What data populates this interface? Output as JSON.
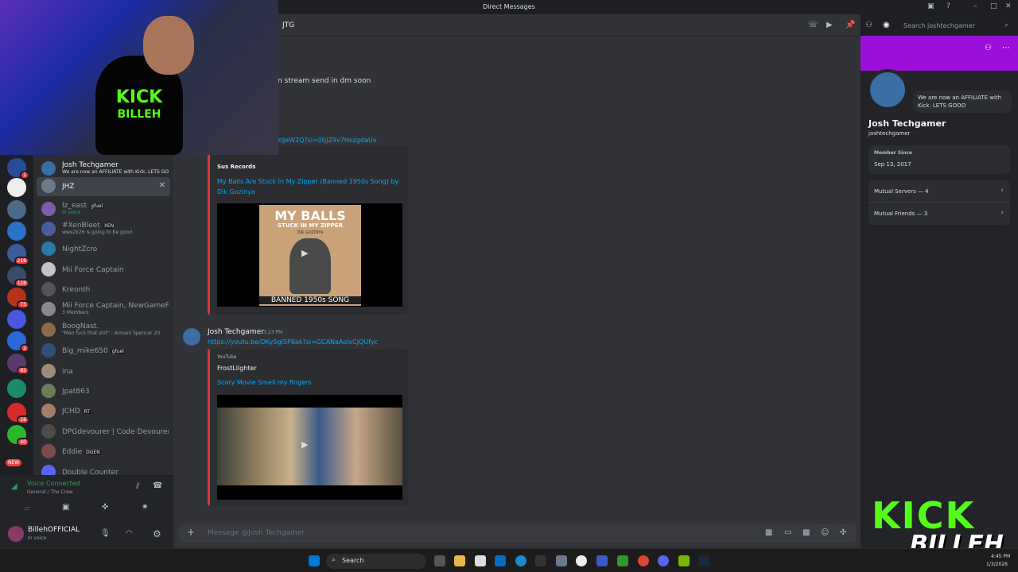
{
  "window": {
    "title": "Direct Messages"
  },
  "header": {
    "channel_name": "JTG",
    "search_placeholder": "Search joshtechgamer"
  },
  "dm_list": [
    {
      "name": "Josh Techgamer",
      "sub": "We are now an AFFILIATE with Kick. LETS GO",
      "color": "#3a6ea5"
    },
    {
      "name": "JHZ",
      "sub": "",
      "active": true,
      "color": "#6b7b8c"
    },
    {
      "name": "Iz_east",
      "tag": "gfuel",
      "sub": "In voice",
      "color": "#7b5ea7"
    },
    {
      "name": "#XenBleet",
      "tag": "XEN",
      "sub": "wwe2k26 is going to be good",
      "color": "#4b5b9c"
    },
    {
      "name": "NightZcro",
      "sub": "",
      "color": "#2d7aa8"
    },
    {
      "name": "Mii Force Captain",
      "sub": "",
      "color": "#c4c4c4"
    },
    {
      "name": "Kreonth",
      "sub": "",
      "color": "#555555"
    },
    {
      "name": "Mii Force Captain, NewGameFa...",
      "sub": "3 Members",
      "color": "#888888"
    },
    {
      "name": "BoogNast.",
      "sub": "\"Man fuck that shit\" - Armani Spencer 20",
      "color": "#8c6a4a"
    },
    {
      "name": "Big_mike650",
      "tag": "gfuel",
      "sub": "",
      "color": "#2f4f7f"
    },
    {
      "name": "ina",
      "sub": "",
      "color": "#9c8c7c"
    },
    {
      "name": "Jpat863",
      "sub": "",
      "color": "#6c7c5c"
    },
    {
      "name": "JCHD",
      "tag": "RT",
      "sub": "",
      "color": "#a57c6a"
    },
    {
      "name": "DPGdevourer | Code Devourer...",
      "sub": "",
      "color": "#4c4c4c"
    },
    {
      "name": "Eddie",
      "tag": "DGEN",
      "sub": "",
      "color": "#7c4c4c"
    },
    {
      "name": "Double Counter",
      "sub": "",
      "color": "#5865f2"
    }
  ],
  "server_badges": [
    "1",
    "218",
    "128",
    "73",
    "2",
    "82",
    "16",
    "40"
  ],
  "new_badge": "NEW",
  "voice": {
    "status": "Voice Connected",
    "channel": "General / The Crew"
  },
  "user": {
    "name": "BillehOFFICIAL",
    "status": "In voice"
  },
  "messages": [
    {
      "text_partial": "n stream send in dm soon"
    },
    {
      "link_partial": "klJeW2Q?si=0tjjZ9v7HozgdaUv"
    }
  ],
  "embed1": {
    "provider": "Sus Records",
    "title": "My Balls Are Stuck In My Zipper (Banned 1950s Song) by Dik Gozinya",
    "thumb_top": "MY BALLS",
    "thumb_mid": "STUCK IN MY ZIPPER",
    "thumb_artist": "DIK GOZINYA",
    "thumb_bottom": "BANNED 1950s SONG"
  },
  "message2": {
    "author": "Josh Techgamer",
    "time": "3:23 PM",
    "link": "https://youtu.be/DKy5gI5P8ak?si=GCANaAolxCJQUfyc"
  },
  "embed2": {
    "provider": "YouTube",
    "author": "FrostLlighter",
    "title": "Scary Movie Smell my fingers"
  },
  "chat_input": {
    "placeholder": "Message @Josh Techgamer"
  },
  "profile": {
    "display_name": "Josh Techgamer",
    "username": "joshtechgamer",
    "status_bubble": "We are now an AFFILIATE with Kick. LETS GOOO",
    "member_since_label": "Member Since",
    "member_since": "Sep 13, 2017",
    "mutual_servers": "Mutual Servers — 4",
    "mutual_friends": "Mutual Friends — 3"
  },
  "taskbar": {
    "search_label": "Search",
    "clock_time": "4:45 PM",
    "clock_date": "1/3/2026"
  },
  "overlay": {
    "kick_word": "KICK",
    "billeh_word": "BILLEH",
    "shirt_top": "KICK",
    "shirt_bottom": "BILLEH"
  },
  "colors": {
    "accent": "#5865f2",
    "banner": "#9b10d8",
    "link": "#00a8fc",
    "voice_green": "#23a55a",
    "kick_green": "#53fc18"
  }
}
